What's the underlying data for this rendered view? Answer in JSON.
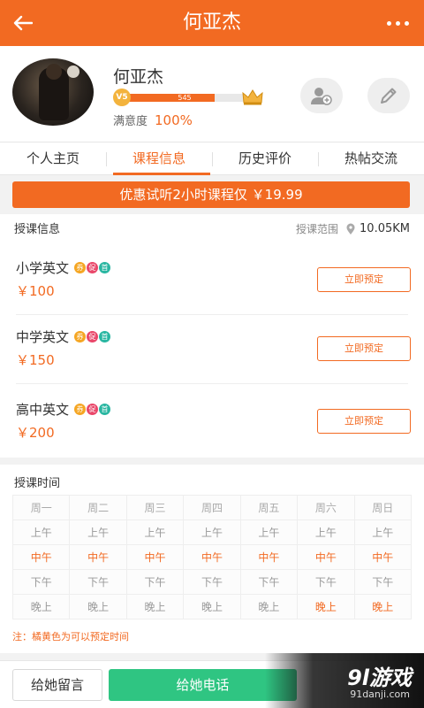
{
  "header": {
    "title": "何亚杰"
  },
  "profile": {
    "name": "何亚杰",
    "level_badge": "V5",
    "level_points": "545",
    "level_progress": 0.75,
    "satisfaction_label": "满意度",
    "satisfaction_value": "100%"
  },
  "tabs": [
    {
      "label": "个人主页",
      "active": false
    },
    {
      "label": "课程信息",
      "active": true
    },
    {
      "label": "历史评价",
      "active": false
    },
    {
      "label": "热帖交流",
      "active": false
    }
  ],
  "promo": "优惠试听2小时课程仅 ￥19.99",
  "teaching": {
    "title": "授课信息",
    "range_label": "授课范围",
    "range_value": "10.05KM",
    "tag_labels": [
      "券",
      "促",
      "首"
    ],
    "book_label": "立即预定",
    "courses": [
      {
        "name": "小学英文",
        "price": "￥100"
      },
      {
        "name": "中学英文",
        "price": "￥150"
      },
      {
        "name": "高中英文",
        "price": "￥200"
      }
    ]
  },
  "schedule": {
    "title": "授课时间",
    "days": [
      "周一",
      "周二",
      "周三",
      "周四",
      "周五",
      "周六",
      "周日"
    ],
    "rows": [
      {
        "label": "上午",
        "available": [
          false,
          false,
          false,
          false,
          false,
          false,
          false
        ]
      },
      {
        "label": "中午",
        "available": [
          true,
          true,
          true,
          true,
          true,
          true,
          true
        ]
      },
      {
        "label": "下午",
        "available": [
          false,
          false,
          false,
          false,
          false,
          false,
          false
        ]
      },
      {
        "label": "晚上",
        "available": [
          false,
          false,
          false,
          false,
          false,
          true,
          true
        ]
      }
    ],
    "note": "注：橘黄色为可以预定时间"
  },
  "bottom": {
    "message_label": "给她留言",
    "call_label": "给她电话"
  },
  "watermark": {
    "brand": "9l游戏",
    "site": "91danji.com"
  },
  "colors": {
    "accent": "#f26a22",
    "call_green": "#2fc582"
  }
}
